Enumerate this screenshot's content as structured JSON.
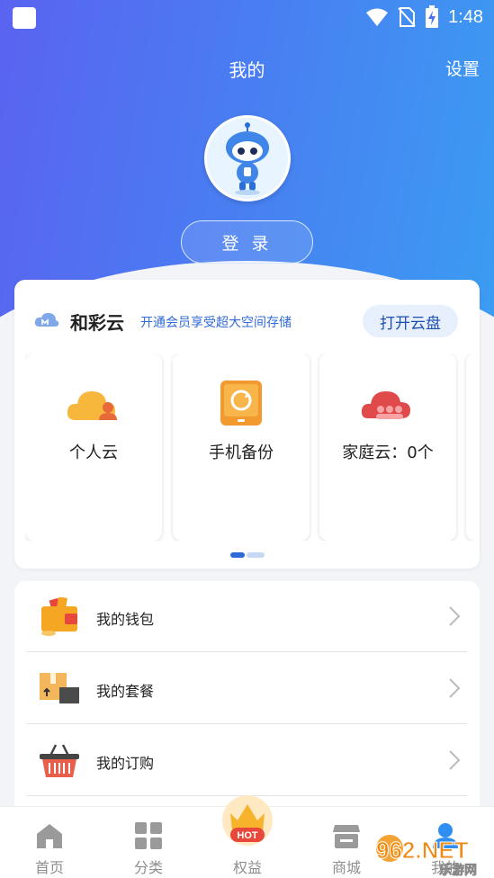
{
  "status_bar": {
    "time": "1:48"
  },
  "header": {
    "title": "我的",
    "settings_label": "设置",
    "login_label": "登 录"
  },
  "cloud": {
    "name": "和彩云",
    "promo": "开通会员享受超大空间存储",
    "open_button": "打开云盘",
    "tiles": [
      {
        "label": "个人云",
        "icon": "personal-cloud-icon"
      },
      {
        "label": "手机备份",
        "icon": "phone-backup-icon"
      },
      {
        "label": "家庭云：0个",
        "icon": "family-cloud-icon"
      }
    ],
    "page_indicator": {
      "current": 1,
      "total": 2
    }
  },
  "menu": [
    {
      "label": "我的钱包",
      "icon": "wallet-icon"
    },
    {
      "label": "我的套餐",
      "icon": "package-icon"
    },
    {
      "label": "我的订购",
      "icon": "basket-icon"
    }
  ],
  "bottom_nav": {
    "items": [
      {
        "label": "首页",
        "icon": "home-icon"
      },
      {
        "label": "分类",
        "icon": "category-icon"
      },
      {
        "label": "权益",
        "icon": "rights-icon"
      },
      {
        "label": "商城",
        "icon": "store-icon"
      },
      {
        "label": "我的",
        "icon": "profile-icon"
      }
    ],
    "hot_badge": "HOT"
  },
  "watermark": {
    "text": "962.NET",
    "subtext": "乐游网"
  },
  "colors": {
    "brand_blue": "#2f6ad8",
    "header_start": "#5a63f0",
    "header_end": "#3b9cf2",
    "cloud_yellow": "#f6b73c",
    "family_red": "#e04a4a"
  }
}
